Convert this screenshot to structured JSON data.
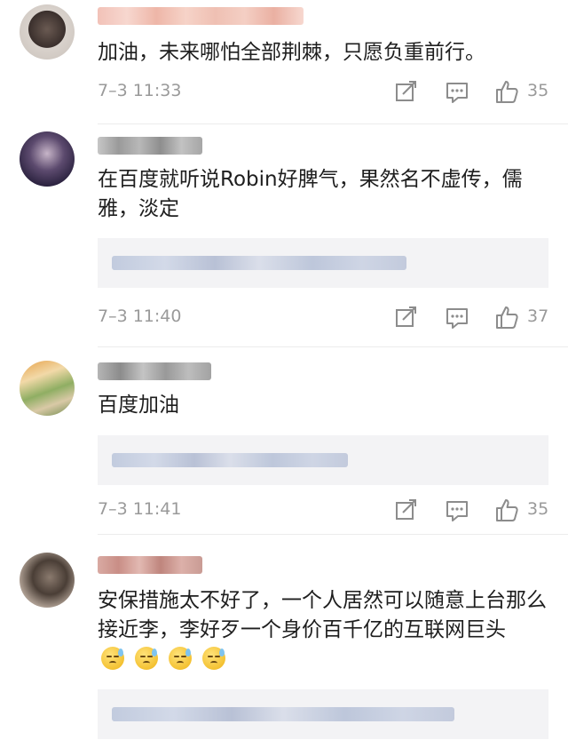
{
  "comments": [
    {
      "text": "加油，未来哪怕全部荆棘，只愿负重前行。",
      "time": "7–3 11:33",
      "likes": "35",
      "has_replies": false
    },
    {
      "text": "在百度就听说Robin好脾气，果然名不虚传，儒雅，淡定",
      "time": "7–3 11:40",
      "likes": "37",
      "has_replies": true
    },
    {
      "text": "百度加油",
      "time": "7–3 11:41",
      "likes": "35",
      "has_replies": true
    },
    {
      "text": "安保措施太不好了，一个人居然可以随意上台那么接近李，李好歹一个身价百千亿的互联网巨头",
      "emoji_count": 4,
      "emoji_name": "sweat-emoji",
      "has_replies": true
    }
  ],
  "icons": {
    "repost": "repost-icon",
    "comment": "comment-icon",
    "like": "thumbs-up-icon"
  },
  "colors": {
    "meta_text": "#9a9a9a",
    "reply_bg": "#f3f3f5",
    "reply_link": "#b9c4da"
  }
}
